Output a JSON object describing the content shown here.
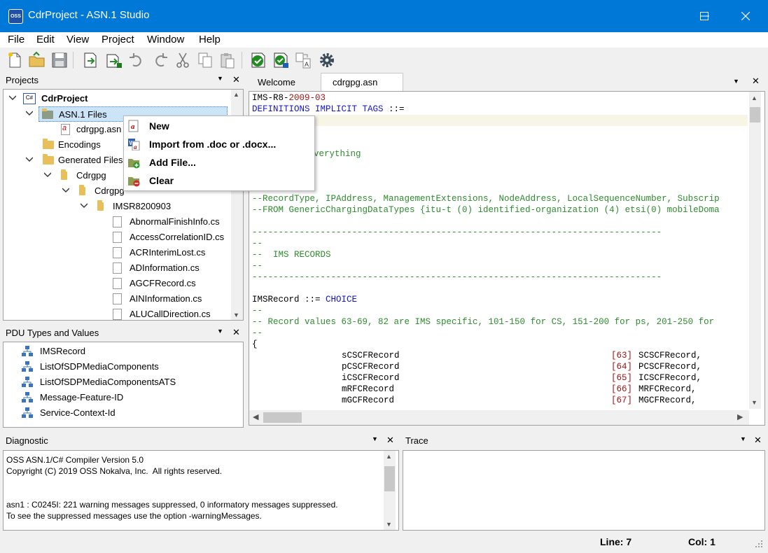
{
  "window": {
    "app_icon_text": "OSS",
    "title": "CdrProject - ASN.1 Studio"
  },
  "menu": [
    "File",
    "Edit",
    "View",
    "Project",
    "Window",
    "Help"
  ],
  "toolbar_icons": [
    "new-file-icon",
    "open-folder-icon",
    "save-icon",
    "export-icon",
    "export-all-icon",
    "undo-icon",
    "redo-icon",
    "cut-icon",
    "copy-icon",
    "paste-icon",
    "check-icon",
    "check-all-icon",
    "convert-icon",
    "settings-icon"
  ],
  "projects_panel": {
    "title": "Projects",
    "tree": {
      "project": "CdrProject",
      "project_icon_text": "C#",
      "asn_files": "ASN.1 Files",
      "asn_file": "cdrgpg.asn",
      "encodings": "Encodings",
      "generated_files": "Generated Files",
      "cdrgpg1": "Cdrgpg",
      "cdrgpg2": "Cdrgpg",
      "imsr": "IMSR8200903",
      "files": [
        "AbnormalFinishInfo.cs",
        "AccessCorrelationID.cs",
        "ACRInterimLost.cs",
        "ADInformation.cs",
        "AGCFRecord.cs",
        "AINInformation.cs",
        "ALUCallDirection.cs"
      ]
    }
  },
  "context_menu": {
    "items": [
      {
        "label": "New",
        "icon": "asn-file-icon"
      },
      {
        "label": "Import from .doc or .docx...",
        "icon": "import-word-icon"
      },
      {
        "label": "Add File...",
        "icon": "add-folder-icon"
      },
      {
        "label": "Clear",
        "icon": "clear-folder-icon"
      }
    ]
  },
  "pdu_panel": {
    "title": "PDU Types and Values",
    "items": [
      "IMSRecord",
      "ListOfSDPMediaComponents",
      "ListOfSDPMediaComponentsATS",
      "Message-Feature-ID",
      "Service-Context-Id"
    ]
  },
  "editor": {
    "tabs": [
      "Welcome",
      "cdrgpg.asn"
    ],
    "lines": {
      "l1_a": "IMS-R8-",
      "l1_b": "2009-03",
      "l2_a": "DEFINITIONS IMPLICIT TAGS",
      "l2_b": " ::=",
      "l6": "verything",
      "l10": "--RecordType, IPAddress, ManagementExtensions, NodeAddress, LocalSequenceNumber, Subscrip",
      "l11": "--FROM GenericChargingDataTypes {itu-t (0) identified-organization (4) etsi(0) mobileDoma",
      "l13": "------------------------------------------------------------------------------",
      "l14": "--",
      "l15": "--  IMS RECORDS",
      "l16": "--",
      "l17": "------------------------------------------------------------------------------",
      "l19_a": "IMSRecord ::= ",
      "l19_b": "CHOICE",
      "l20": "--",
      "l21": "-- Record values 63-69, 82 are IMS specific, 101-150 for CS, 151-200 for ps, 201-250 for",
      "l22": "--",
      "l23": "{",
      "records": [
        {
          "field": "sCSCFRecord",
          "tag": "[63]",
          "type": "SCSCFRecord,"
        },
        {
          "field": "pCSCFRecord",
          "tag": "[64]",
          "type": "PCSCFRecord,"
        },
        {
          "field": "iCSCFRecord",
          "tag": "[65]",
          "type": "ICSCFRecord,"
        },
        {
          "field": "mRFCRecord",
          "tag": "[66]",
          "type": "MRFCRecord,"
        },
        {
          "field": "mGCFRecord",
          "tag": "[67]",
          "type": "MGCFRecord,"
        }
      ]
    }
  },
  "diagnostic": {
    "title": "Diagnostic",
    "lines": [
      "OSS ASN.1/C# Compiler Version 5.0",
      "Copyright (C) 2019 OSS Nokalva, Inc.  All rights reserved.",
      "asn1 : C0245I: 221 warning messages suppressed, 0 informatory messages suppressed.",
      "To see the suppressed messages use the option -warningMessages."
    ]
  },
  "trace": {
    "title": "Trace"
  },
  "status": {
    "line": "Line: 7",
    "col": "Col: 1"
  }
}
